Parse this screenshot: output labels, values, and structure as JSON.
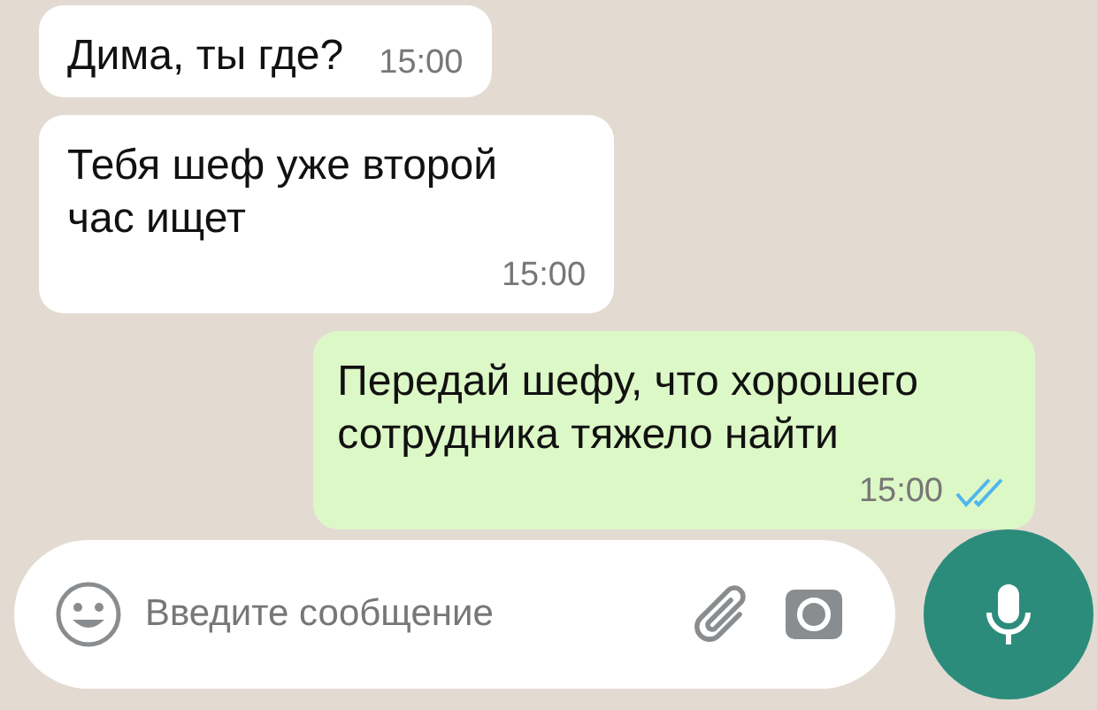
{
  "messages": [
    {
      "outgoing": false,
      "lines": [
        "Дима, ты где?"
      ],
      "time": "15:00"
    },
    {
      "outgoing": false,
      "lines": [
        "Тебя шеф уже второй",
        "час ищет"
      ],
      "time": "15:00"
    },
    {
      "outgoing": true,
      "lines": [
        "Передай шефу, что хорошего",
        "сотрудника тяжело найти"
      ],
      "time": "15:00",
      "read": true
    }
  ],
  "composer": {
    "placeholder": "Введите сообщение"
  }
}
